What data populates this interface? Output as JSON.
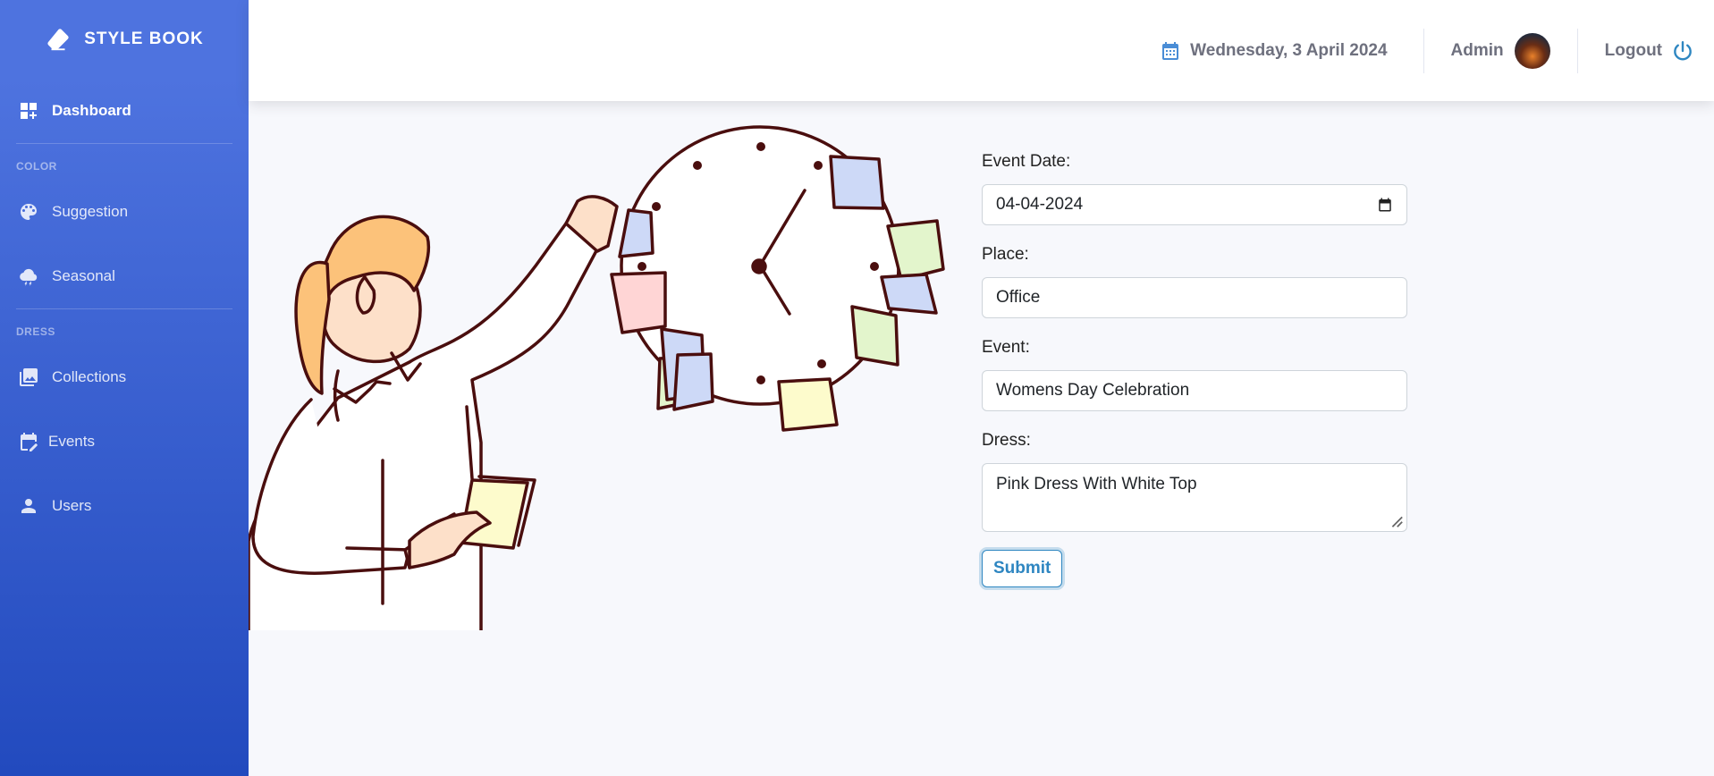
{
  "brand": {
    "name": "STYLE BOOK",
    "icon": "eraser-icon"
  },
  "sidebar": {
    "dashboard": {
      "label": "Dashboard",
      "icon": "dashboard-add-icon"
    },
    "sections": [
      {
        "heading": "COLOR",
        "items": [
          {
            "label": "Suggestion",
            "icon": "palette-icon"
          },
          {
            "label": "Seasonal",
            "icon": "storm-cloud-icon"
          }
        ]
      },
      {
        "heading": "DRESS",
        "items": [
          {
            "label": "Collections",
            "icon": "photo-library-icon"
          },
          {
            "label": "Events",
            "icon": "calendar-edit-icon"
          },
          {
            "label": "Users",
            "icon": "person-icon"
          }
        ]
      }
    ]
  },
  "topbar": {
    "date": "Wednesday, 3 April 2024",
    "user": "Admin",
    "logout": "Logout"
  },
  "form": {
    "event_date_label": "Event Date:",
    "event_date_value": "04-04-2024",
    "place_label": "Place:",
    "place_value": "Office",
    "event_label": "Event:",
    "event_value": "Womens Day Celebration",
    "dress_label": "Dress:",
    "dress_value": "Pink Dress With White Top",
    "submit_label": "Submit"
  },
  "colors": {
    "sidebar_top": "#4e73df",
    "sidebar_bottom": "#224abe",
    "accent": "#2e86c1"
  }
}
